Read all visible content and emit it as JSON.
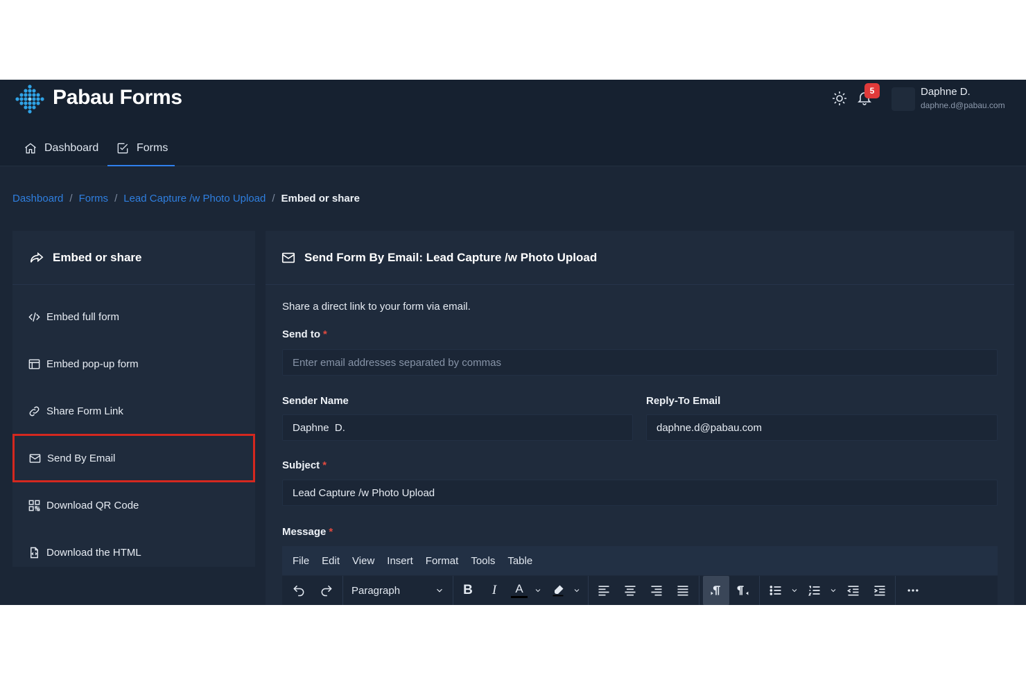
{
  "app": {
    "brand": "Pabau Forms"
  },
  "header": {
    "notification_count": "5",
    "user_name": "Daphne D.",
    "user_email": "daphne.d@pabau.com"
  },
  "nav": [
    {
      "label": "Dashboard",
      "icon": "home-icon"
    },
    {
      "label": "Forms",
      "icon": "checkbox-icon",
      "active": true
    }
  ],
  "breadcrumb": {
    "items": [
      "Dashboard",
      "Forms",
      "Lead Capture /w Photo Upload"
    ],
    "separator": "/",
    "current": "Embed or share"
  },
  "sidebar": {
    "title": "Embed or share",
    "items": [
      {
        "label": "Embed full form",
        "icon": "code-icon"
      },
      {
        "label": "Embed pop-up form",
        "icon": "window-icon"
      },
      {
        "label": "Share Form Link",
        "icon": "link-icon"
      },
      {
        "label": "Send By Email",
        "icon": "mail-icon",
        "selected": true
      },
      {
        "label": "Download QR Code",
        "icon": "qr-code-icon"
      },
      {
        "label": "Download the HTML",
        "icon": "file-code-icon"
      }
    ]
  },
  "main": {
    "title": "Send Form By Email: Lead Capture /w Photo Upload",
    "description": "Share a direct link to your form via email.",
    "send_to": {
      "label": "Send to",
      "required": "*",
      "placeholder": "Enter email addresses separated by commas",
      "value": ""
    },
    "sender_name": {
      "label": "Sender Name",
      "value": "Daphne  D."
    },
    "reply_to": {
      "label": "Reply-To Email",
      "value": "daphne.d@pabau.com"
    },
    "subject": {
      "label": "Subject",
      "required": "*",
      "value": "Lead Capture /w Photo Upload"
    },
    "message": {
      "label": "Message",
      "required": "*"
    }
  },
  "editor": {
    "menu": [
      "File",
      "Edit",
      "View",
      "Insert",
      "Format",
      "Tools",
      "Table"
    ],
    "block_format": "Paragraph",
    "bold": "B",
    "italic": "I",
    "text_color_glyph": "A"
  },
  "colors": {
    "background": "#1b2636",
    "panel": "#1f2b3c",
    "accent": "#2f80ed",
    "highlight_border": "#d4281f",
    "badge": "#e03a3a"
  }
}
